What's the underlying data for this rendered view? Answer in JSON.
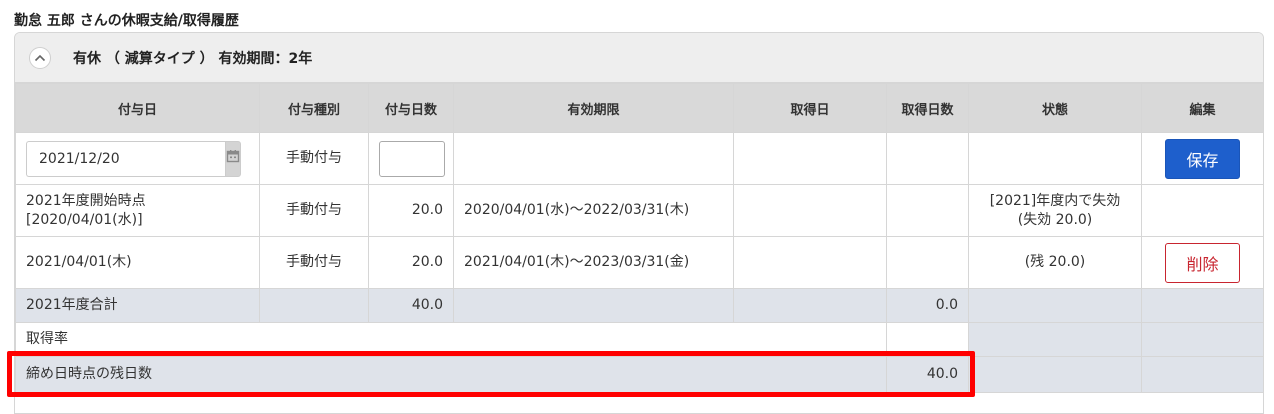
{
  "page_title": "勤怠 五郎 さんの休暇支給/取得履歴",
  "panel_title": "有休 （ 減算タイプ ） 有効期間：2年",
  "headers": {
    "grant_date": "付与日",
    "grant_type": "付与種別",
    "grant_days": "付与日数",
    "validity": "有効期限",
    "taken_date": "取得日",
    "taken_days": "取得日数",
    "status": "状態",
    "edit": "編集"
  },
  "new_row": {
    "date_value": "2021/12/20",
    "grant_type": "手動付与",
    "grant_days_value": "",
    "save_label": "保存"
  },
  "rows": [
    {
      "grant_date_line1": "2021年度開始時点",
      "grant_date_line2": "[2020/04/01(水)]",
      "grant_type": "手動付与",
      "grant_days": "20.0",
      "validity": "2020/04/01(水)〜2022/03/31(木)",
      "status_line1": "[2021]年度内で失効",
      "status_line2": "(失効 20.0)"
    },
    {
      "grant_date": "2021/04/01(木)",
      "grant_type": "手動付与",
      "grant_days": "20.0",
      "validity": "2021/04/01(木)〜2023/03/31(金)",
      "status": "(残 20.0)",
      "delete_label": "削除"
    }
  ],
  "total": {
    "label": "2021年度合計",
    "grant_days": "40.0",
    "taken_days": "0.0"
  },
  "rate": {
    "label": "取得率"
  },
  "remaining": {
    "label": "締め日時点の残日数",
    "value": "40.0"
  },
  "colors": {
    "save_button": "#1e5fcc",
    "delete_button": "#c8252f",
    "highlight": "#ff0000",
    "summary_row": "#dfe3ea"
  }
}
